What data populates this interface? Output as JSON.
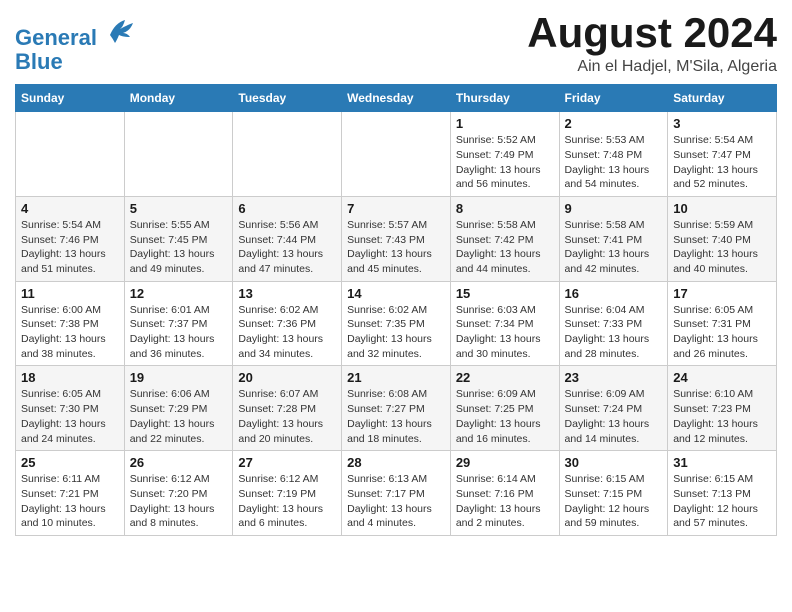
{
  "header": {
    "logo_line1": "General",
    "logo_line2": "Blue",
    "month_title": "August 2024",
    "location": "Ain el Hadjel, M'Sila, Algeria"
  },
  "weekdays": [
    "Sunday",
    "Monday",
    "Tuesday",
    "Wednesday",
    "Thursday",
    "Friday",
    "Saturday"
  ],
  "weeks": [
    [
      {
        "day": "",
        "info": ""
      },
      {
        "day": "",
        "info": ""
      },
      {
        "day": "",
        "info": ""
      },
      {
        "day": "",
        "info": ""
      },
      {
        "day": "1",
        "info": "Sunrise: 5:52 AM\nSunset: 7:49 PM\nDaylight: 13 hours\nand 56 minutes."
      },
      {
        "day": "2",
        "info": "Sunrise: 5:53 AM\nSunset: 7:48 PM\nDaylight: 13 hours\nand 54 minutes."
      },
      {
        "day": "3",
        "info": "Sunrise: 5:54 AM\nSunset: 7:47 PM\nDaylight: 13 hours\nand 52 minutes."
      }
    ],
    [
      {
        "day": "4",
        "info": "Sunrise: 5:54 AM\nSunset: 7:46 PM\nDaylight: 13 hours\nand 51 minutes."
      },
      {
        "day": "5",
        "info": "Sunrise: 5:55 AM\nSunset: 7:45 PM\nDaylight: 13 hours\nand 49 minutes."
      },
      {
        "day": "6",
        "info": "Sunrise: 5:56 AM\nSunset: 7:44 PM\nDaylight: 13 hours\nand 47 minutes."
      },
      {
        "day": "7",
        "info": "Sunrise: 5:57 AM\nSunset: 7:43 PM\nDaylight: 13 hours\nand 45 minutes."
      },
      {
        "day": "8",
        "info": "Sunrise: 5:58 AM\nSunset: 7:42 PM\nDaylight: 13 hours\nand 44 minutes."
      },
      {
        "day": "9",
        "info": "Sunrise: 5:58 AM\nSunset: 7:41 PM\nDaylight: 13 hours\nand 42 minutes."
      },
      {
        "day": "10",
        "info": "Sunrise: 5:59 AM\nSunset: 7:40 PM\nDaylight: 13 hours\nand 40 minutes."
      }
    ],
    [
      {
        "day": "11",
        "info": "Sunrise: 6:00 AM\nSunset: 7:38 PM\nDaylight: 13 hours\nand 38 minutes."
      },
      {
        "day": "12",
        "info": "Sunrise: 6:01 AM\nSunset: 7:37 PM\nDaylight: 13 hours\nand 36 minutes."
      },
      {
        "day": "13",
        "info": "Sunrise: 6:02 AM\nSunset: 7:36 PM\nDaylight: 13 hours\nand 34 minutes."
      },
      {
        "day": "14",
        "info": "Sunrise: 6:02 AM\nSunset: 7:35 PM\nDaylight: 13 hours\nand 32 minutes."
      },
      {
        "day": "15",
        "info": "Sunrise: 6:03 AM\nSunset: 7:34 PM\nDaylight: 13 hours\nand 30 minutes."
      },
      {
        "day": "16",
        "info": "Sunrise: 6:04 AM\nSunset: 7:33 PM\nDaylight: 13 hours\nand 28 minutes."
      },
      {
        "day": "17",
        "info": "Sunrise: 6:05 AM\nSunset: 7:31 PM\nDaylight: 13 hours\nand 26 minutes."
      }
    ],
    [
      {
        "day": "18",
        "info": "Sunrise: 6:05 AM\nSunset: 7:30 PM\nDaylight: 13 hours\nand 24 minutes."
      },
      {
        "day": "19",
        "info": "Sunrise: 6:06 AM\nSunset: 7:29 PM\nDaylight: 13 hours\nand 22 minutes."
      },
      {
        "day": "20",
        "info": "Sunrise: 6:07 AM\nSunset: 7:28 PM\nDaylight: 13 hours\nand 20 minutes."
      },
      {
        "day": "21",
        "info": "Sunrise: 6:08 AM\nSunset: 7:27 PM\nDaylight: 13 hours\nand 18 minutes."
      },
      {
        "day": "22",
        "info": "Sunrise: 6:09 AM\nSunset: 7:25 PM\nDaylight: 13 hours\nand 16 minutes."
      },
      {
        "day": "23",
        "info": "Sunrise: 6:09 AM\nSunset: 7:24 PM\nDaylight: 13 hours\nand 14 minutes."
      },
      {
        "day": "24",
        "info": "Sunrise: 6:10 AM\nSunset: 7:23 PM\nDaylight: 13 hours\nand 12 minutes."
      }
    ],
    [
      {
        "day": "25",
        "info": "Sunrise: 6:11 AM\nSunset: 7:21 PM\nDaylight: 13 hours\nand 10 minutes."
      },
      {
        "day": "26",
        "info": "Sunrise: 6:12 AM\nSunset: 7:20 PM\nDaylight: 13 hours\nand 8 minutes."
      },
      {
        "day": "27",
        "info": "Sunrise: 6:12 AM\nSunset: 7:19 PM\nDaylight: 13 hours\nand 6 minutes."
      },
      {
        "day": "28",
        "info": "Sunrise: 6:13 AM\nSunset: 7:17 PM\nDaylight: 13 hours\nand 4 minutes."
      },
      {
        "day": "29",
        "info": "Sunrise: 6:14 AM\nSunset: 7:16 PM\nDaylight: 13 hours\nand 2 minutes."
      },
      {
        "day": "30",
        "info": "Sunrise: 6:15 AM\nSunset: 7:15 PM\nDaylight: 12 hours\nand 59 minutes."
      },
      {
        "day": "31",
        "info": "Sunrise: 6:15 AM\nSunset: 7:13 PM\nDaylight: 12 hours\nand 57 minutes."
      }
    ]
  ]
}
